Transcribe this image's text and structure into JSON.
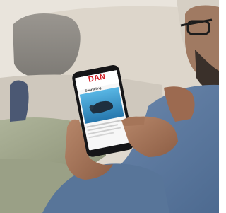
{
  "photo": {
    "description_visible": "",
    "phone_screen": {
      "brand": "DAN",
      "nav_text": "",
      "headline": "Snorkeling"
    }
  },
  "colors": {
    "brand_red": "#d32027",
    "sweater_blue": "#5e7a9e",
    "sofa_beige": "#d9d3c9",
    "water_blue": "#2f9ad0"
  }
}
